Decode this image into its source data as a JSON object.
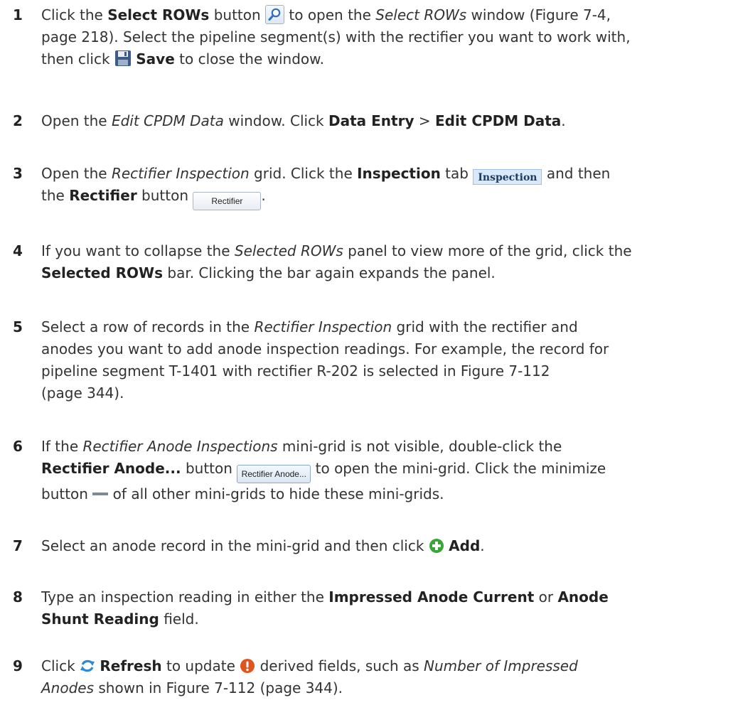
{
  "steps": [
    {
      "num": "1",
      "t1": "Click the ",
      "b1": "Select ROWs",
      "t2": " button ",
      "t3": " to open the ",
      "i1": "Select ROWs",
      "t4": " window (Figure 7-4,",
      "line2": "page 218). Select the pipeline segment(s) with the rectifier you want to work with,",
      "t5": "then click ",
      "b2": "Save",
      "t6": " to close the window."
    },
    {
      "num": "2",
      "t1": "Open the ",
      "i1": "Edit CPDM Data",
      "t2": " window. Click ",
      "b1": "Data Entry",
      "t3": " > ",
      "b2": "Edit CPDM Data",
      "t4": "."
    },
    {
      "num": "3",
      "t1": "Open the ",
      "i1": "Rectifier Inspection",
      "t2": " grid. Click the ",
      "b1": "Inspection",
      "t3": " tab ",
      "tab_label": "Inspection",
      "t4": " and then",
      "t5": "the ",
      "b2": "Rectifier",
      "t6": " button ",
      "btn_label": "Rectifier",
      "t7": "."
    },
    {
      "num": "4",
      "t1": "If you want to collapse the ",
      "i1": "Selected ROWs",
      "t2": " panel to view more of the grid, click the",
      "b1": "Selected ROWs",
      "t3": " bar. Clicking the bar again expands the panel."
    },
    {
      "num": "5",
      "t1": "Select a row of records in the ",
      "i1": "Rectifier Inspection",
      "t2": " grid with the rectifier and",
      "line2": "anodes you want to add anode inspection readings. For example, the record for",
      "line3": "pipeline segment T-1401 with rectifier R-202 is selected in Figure 7-112",
      "line4": "(page 344)."
    },
    {
      "num": "6",
      "t1": "If the ",
      "i1": "Rectifier Anode Inspections",
      "t2": " mini-grid is not visible, double-click the",
      "b1": "Rectifier Anode...",
      "t3": " button ",
      "btn_label": "Rectifier Anode...",
      "t4": " to open the mini-grid. Click the minimize",
      "t5": "button ",
      "t6": " of all other mini-grids to hide these mini-grids."
    },
    {
      "num": "7",
      "t1": "Select an anode record in the mini-grid and then click ",
      "b1": "Add",
      "t2": "."
    },
    {
      "num": "8",
      "t1": "Type an inspection reading in either the ",
      "b1": "Impressed Anode Current",
      "t2": " or ",
      "b2": "Anode",
      "b3": "Shunt Reading",
      "t3": " field."
    },
    {
      "num": "9",
      "t1": "Click ",
      "b1": "Refresh",
      "t2": " to update ",
      "t3": " derived fields, such as ",
      "i1": "Number of Impressed",
      "i2": "Anodes",
      "t4": " shown in Figure 7-112 (page 344)."
    }
  ],
  "icons": {
    "search": "search-icon",
    "save": "save-icon",
    "minimize": "minimize-icon",
    "add": "add-icon",
    "refresh": "refresh-icon",
    "warning": "warning-icon"
  },
  "colors": {
    "text": "#333333",
    "tab_bg": "#d9e9fa",
    "add_green": "#3aa63a",
    "refresh_blue": "#2e8ad6",
    "warn_red": "#e0551f"
  }
}
